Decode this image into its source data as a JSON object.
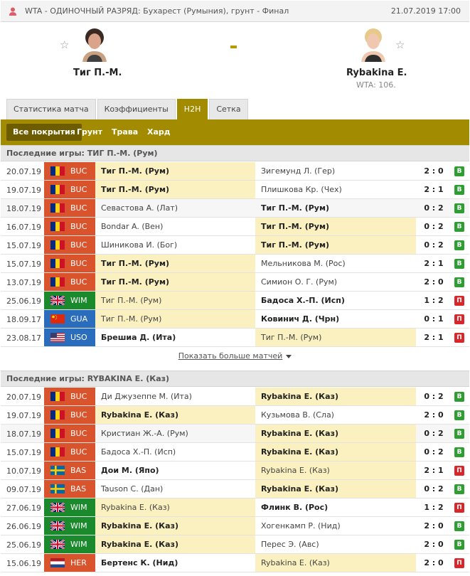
{
  "topbar": {
    "league": "WTA - ОДИНОЧНЫЙ РАЗРЯД: Бухарест (Румыния), грунт - Финал",
    "datetime": "21.07.2019 17:00"
  },
  "match": {
    "home": {
      "name": "Тиг П.-М."
    },
    "away": {
      "name": "Rybakina E.",
      "rank": "WTA: 106."
    },
    "separator": "-"
  },
  "tabs": [
    "Статистика матча",
    "Коэффициенты",
    "H2H",
    "Сетка"
  ],
  "active_tab": "H2H",
  "surfaces": [
    "Все покрытия",
    "Грунт",
    "Трава",
    "Хард"
  ],
  "show_more_label": "Показать больше матчей",
  "sections": [
    {
      "title": "Последние игры: ТИГ П.-М. (Рум)",
      "rows": [
        {
          "date": "20.07.19",
          "tour": "BUC",
          "flag": "ro",
          "home": "Тиг П.-М. (Рум)",
          "away": "Зигемунд Л. (Гер)",
          "winner": "home",
          "hl": "home",
          "score": "2 : 0",
          "res": "В"
        },
        {
          "date": "19.07.19",
          "tour": "BUC",
          "flag": "ro",
          "home": "Тиг П.-М. (Рум)",
          "away": "Плишкова Кр. (Чех)",
          "winner": "home",
          "hl": "home",
          "score": "2 : 1",
          "res": "В"
        },
        {
          "date": "18.07.19",
          "tour": "BUC",
          "flag": "ro",
          "home": "Севастова А. (Лат)",
          "away": "Тиг П.-М. (Рум)",
          "winner": "away",
          "hl": "none",
          "score": "0 : 2",
          "res": "В"
        },
        {
          "date": "16.07.19",
          "tour": "BUC",
          "flag": "ro",
          "home": "Bondar A. (Вен)",
          "away": "Тиг П.-М. (Рум)",
          "winner": "away",
          "hl": "away",
          "score": "0 : 2",
          "res": "В"
        },
        {
          "date": "15.07.19",
          "tour": "BUC",
          "flag": "ro",
          "home": "Шиникова И. (Бог)",
          "away": "Тиг П.-М. (Рум)",
          "winner": "away",
          "hl": "away",
          "score": "0 : 2",
          "res": "В"
        },
        {
          "date": "15.07.19",
          "tour": "BUC",
          "flag": "ro",
          "home": "Тиг П.-М. (Рум)",
          "away": "Мельникова М. (Рос)",
          "winner": "home",
          "hl": "home",
          "score": "2 : 1",
          "res": "В"
        },
        {
          "date": "13.07.19",
          "tour": "BUC",
          "flag": "ro",
          "home": "Тиг П.-М. (Рум)",
          "away": "Симион О. Г. (Рум)",
          "winner": "home",
          "hl": "home",
          "score": "2 : 0",
          "res": "В"
        },
        {
          "date": "25.06.19",
          "tour": "WIM",
          "flag": "gb",
          "home": "Тиг П.-М. (Рум)",
          "away": "Бадоса Х.-П. (Исп)",
          "winner": "away",
          "hl": "home",
          "score": "1 : 2",
          "res": "П"
        },
        {
          "date": "18.09.17",
          "tour": "GUA",
          "flag": "cn",
          "home": "Тиг П.-М. (Рум)",
          "away": "Ковинич Д. (Чрн)",
          "winner": "away",
          "hl": "home",
          "score": "0 : 1",
          "res": "П"
        },
        {
          "date": "23.08.17",
          "tour": "USO",
          "flag": "us",
          "home": "Брешиа Д. (Ита)",
          "away": "Тиг П.-М. (Рум)",
          "winner": "home",
          "hl": "away",
          "score": "2 : 1",
          "res": "П"
        }
      ]
    },
    {
      "title": "Последние игры: RYBAKINA E. (Каз)",
      "rows": [
        {
          "date": "20.07.19",
          "tour": "BUC",
          "flag": "ro",
          "home": "Ди Джузеппе М. (Ита)",
          "away": "Rybakina E. (Каз)",
          "winner": "away",
          "hl": "away",
          "score": "0 : 2",
          "res": "В"
        },
        {
          "date": "19.07.19",
          "tour": "BUC",
          "flag": "ro",
          "home": "Rybakina E. (Каз)",
          "away": "Кузьмова В. (Сла)",
          "winner": "home",
          "hl": "home",
          "score": "2 : 0",
          "res": "В"
        },
        {
          "date": "18.07.19",
          "tour": "BUC",
          "flag": "ro",
          "home": "Кристиан Ж.-А. (Рум)",
          "away": "Rybakina E. (Каз)",
          "winner": "away",
          "hl": "away",
          "score": "0 : 2",
          "res": "В"
        },
        {
          "date": "15.07.19",
          "tour": "BUC",
          "flag": "ro",
          "home": "Бадоса Х.-П. (Исп)",
          "away": "Rybakina E. (Каз)",
          "winner": "away",
          "hl": "away",
          "score": "0 : 2",
          "res": "В"
        },
        {
          "date": "10.07.19",
          "tour": "BAS",
          "flag": "se",
          "home": "Дои М. (Япо)",
          "away": "Rybakina E. (Каз)",
          "winner": "home",
          "hl": "away",
          "score": "2 : 1",
          "res": "П"
        },
        {
          "date": "09.07.19",
          "tour": "BAS",
          "flag": "se",
          "home": "Tauson C. (Дан)",
          "away": "Rybakina E. (Каз)",
          "winner": "away",
          "hl": "away",
          "score": "0 : 2",
          "res": "В"
        },
        {
          "date": "27.06.19",
          "tour": "WIM",
          "flag": "gb",
          "home": "Rybakina E. (Каз)",
          "away": "Флинк В. (Рос)",
          "winner": "away",
          "hl": "home",
          "score": "1 : 2",
          "res": "П"
        },
        {
          "date": "26.06.19",
          "tour": "WIM",
          "flag": "gb",
          "home": "Rybakina E. (Каз)",
          "away": "Хогенкамп Р. (Нид)",
          "winner": "home",
          "hl": "home",
          "score": "2 : 0",
          "res": "В"
        },
        {
          "date": "25.06.19",
          "tour": "WIM",
          "flag": "gb",
          "home": "Rybakina E. (Каз)",
          "away": "Перес Э. (Авс)",
          "winner": "home",
          "hl": "home",
          "score": "2 : 0",
          "res": "В"
        },
        {
          "date": "15.06.19",
          "tour": "HER",
          "flag": "nl",
          "home": "Бертенс К. (Нид)",
          "away": "Rybakina E. (Каз)",
          "winner": "home",
          "hl": "away",
          "score": "2 : 0",
          "res": "П"
        }
      ]
    }
  ]
}
